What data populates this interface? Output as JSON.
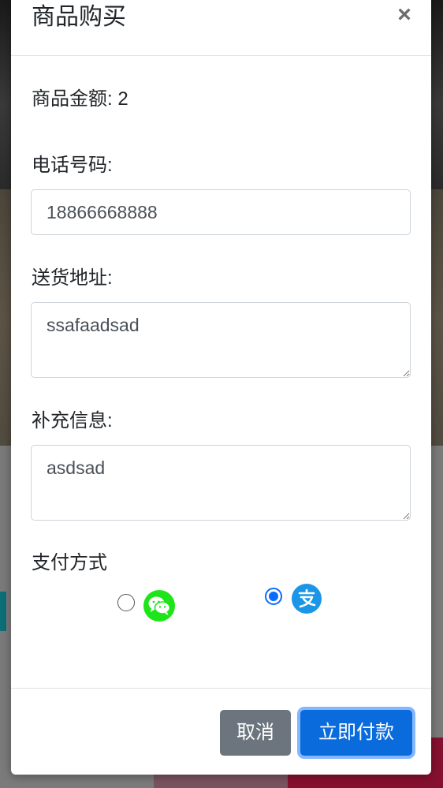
{
  "modal": {
    "title": "商品购买",
    "close_symbol": "×"
  },
  "form": {
    "amount_text": "商品金额: 2",
    "phone_label": "电话号码:",
    "phone_value": "18866668888",
    "address_label": "送货地址:",
    "address_value": "ssafaadsad",
    "extra_label": "补充信息:",
    "extra_value": "asdsad",
    "payment_label": "支付方式",
    "payment_options": [
      {
        "name": "wechat-pay",
        "icon": "wechat-icon",
        "selected": false,
        "color": "#1ee51a"
      },
      {
        "name": "alipay",
        "icon": "alipay-icon",
        "selected": true,
        "color": "#1b96e6"
      }
    ]
  },
  "footer": {
    "cancel_label": "取消",
    "pay_label": "立即付款"
  },
  "colors": {
    "primary": "#0a6cdc",
    "secondary": "#6c757d"
  }
}
